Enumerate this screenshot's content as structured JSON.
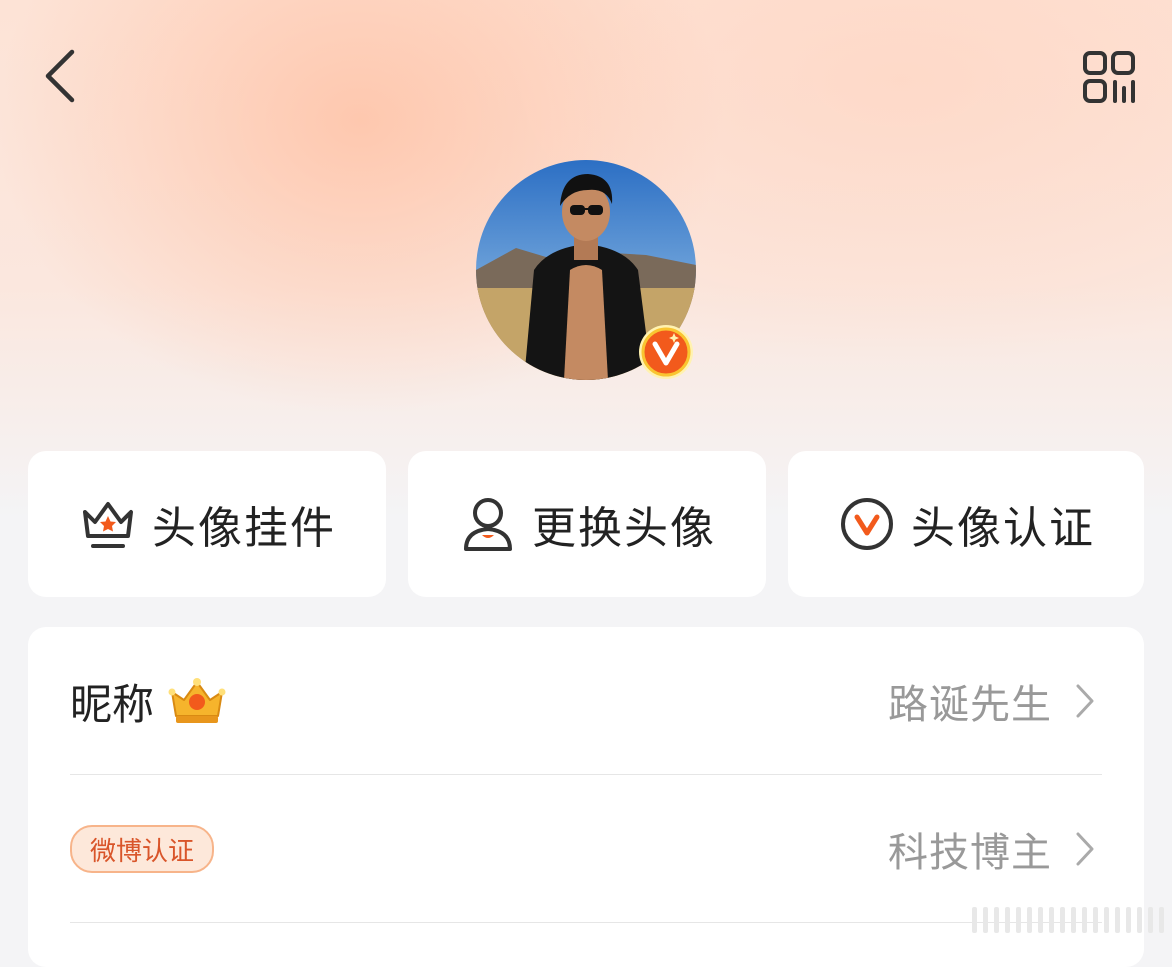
{
  "header": {
    "back_icon": "chevron-left-icon",
    "qr_icon": "qrcode-icon"
  },
  "avatar": {
    "badge_icon": "weibo-v-verified-icon",
    "badge_color": "#f25a1c"
  },
  "actions": [
    {
      "label": "头像挂件",
      "icon": "crown-pendant-icon"
    },
    {
      "label": "更换头像",
      "icon": "person-icon"
    },
    {
      "label": "头像认证",
      "icon": "v-circle-icon"
    }
  ],
  "profile": {
    "nickname": {
      "title": "昵称",
      "badge_icon": "gold-crown-icon",
      "value": "路诞先生"
    },
    "verification": {
      "tag": "微博认证",
      "value": "科技博主"
    }
  },
  "colors": {
    "accent": "#f25a1c",
    "text_primary": "#222222",
    "text_secondary": "#999999",
    "tag_border": "#f7b48a",
    "tag_bg": "#fde8da"
  }
}
